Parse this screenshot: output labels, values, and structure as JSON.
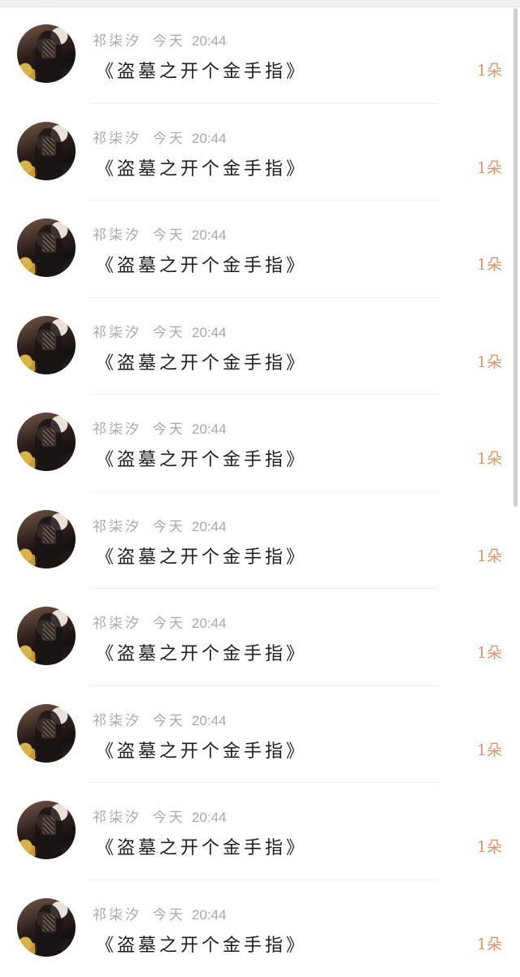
{
  "rows": [
    {
      "name": "祁柒汐",
      "day": "今天",
      "time": "20:44",
      "message": "《盗墓之开个金手指》",
      "count": "1朵"
    },
    {
      "name": "祁柒汐",
      "day": "今天",
      "time": "20:44",
      "message": "《盗墓之开个金手指》",
      "count": "1朵"
    },
    {
      "name": "祁柒汐",
      "day": "今天",
      "time": "20:44",
      "message": "《盗墓之开个金手指》",
      "count": "1朵"
    },
    {
      "name": "祁柒汐",
      "day": "今天",
      "time": "20:44",
      "message": "《盗墓之开个金手指》",
      "count": "1朵"
    },
    {
      "name": "祁柒汐",
      "day": "今天",
      "time": "20:44",
      "message": "《盗墓之开个金手指》",
      "count": "1朵"
    },
    {
      "name": "祁柒汐",
      "day": "今天",
      "time": "20:44",
      "message": "《盗墓之开个金手指》",
      "count": "1朵"
    },
    {
      "name": "祁柒汐",
      "day": "今天",
      "time": "20:44",
      "message": "《盗墓之开个金手指》",
      "count": "1朵"
    },
    {
      "name": "祁柒汐",
      "day": "今天",
      "time": "20:44",
      "message": "《盗墓之开个金手指》",
      "count": "1朵"
    },
    {
      "name": "祁柒汐",
      "day": "今天",
      "time": "20:44",
      "message": "《盗墓之开个金手指》",
      "count": "1朵"
    },
    {
      "name": "祁柒汐",
      "day": "今天",
      "time": "20:44",
      "message": "《盗墓之开个金手指》",
      "count": "1朵"
    }
  ],
  "colors": {
    "meta": "#a8a8a8",
    "message": "#1f1f1f",
    "count": "#e0956a"
  },
  "icons": {
    "avatar": "user-avatar-photo"
  }
}
